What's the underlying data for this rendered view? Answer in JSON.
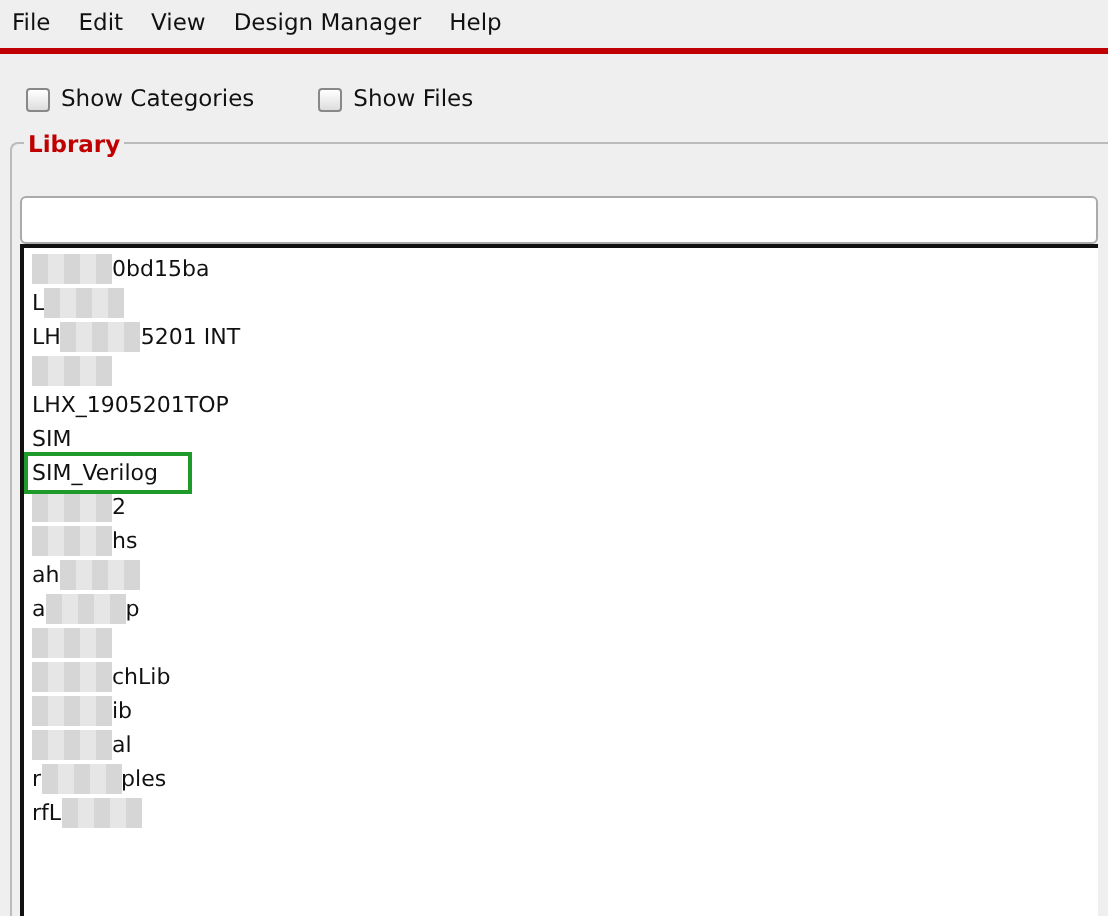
{
  "menu": [
    "File",
    "Edit",
    "View",
    "Design Manager",
    "Help"
  ],
  "options": [
    {
      "label": "Show Categories",
      "checked": false
    },
    {
      "label": "Show Files",
      "checked": false
    }
  ],
  "library": {
    "title": "Library",
    "items": [
      {
        "segments": [
          {
            "kind": "redacted"
          },
          {
            "kind": "text",
            "text": "0bd15ba"
          }
        ],
        "marked": false
      },
      {
        "segments": [
          {
            "kind": "text",
            "text": "L"
          },
          {
            "kind": "redacted"
          }
        ],
        "marked": false
      },
      {
        "segments": [
          {
            "kind": "text",
            "text": "LH"
          },
          {
            "kind": "redacted"
          },
          {
            "kind": "text",
            "text": "5201 INT"
          }
        ],
        "marked": false
      },
      {
        "segments": [
          {
            "kind": "redacted"
          }
        ],
        "marked": false
      },
      {
        "segments": [
          {
            "kind": "text",
            "text": "LHX_1905201TOP"
          }
        ],
        "marked": false
      },
      {
        "segments": [
          {
            "kind": "text",
            "text": "SIM"
          }
        ],
        "marked": false
      },
      {
        "segments": [
          {
            "kind": "text",
            "text": "SIM_Verilog"
          }
        ],
        "marked": true
      },
      {
        "segments": [
          {
            "kind": "redacted"
          },
          {
            "kind": "text",
            "text": "2"
          }
        ],
        "marked": false
      },
      {
        "segments": [
          {
            "kind": "redacted"
          },
          {
            "kind": "text",
            "text": "hs"
          }
        ],
        "marked": false
      },
      {
        "segments": [
          {
            "kind": "text",
            "text": "ah"
          },
          {
            "kind": "redacted"
          }
        ],
        "marked": false
      },
      {
        "segments": [
          {
            "kind": "text",
            "text": "a"
          },
          {
            "kind": "redacted"
          },
          {
            "kind": "text",
            "text": "p"
          }
        ],
        "marked": false
      },
      {
        "segments": [
          {
            "kind": "redacted"
          }
        ],
        "marked": false
      },
      {
        "segments": [
          {
            "kind": "redacted"
          },
          {
            "kind": "text",
            "text": "chLib"
          }
        ],
        "marked": false
      },
      {
        "segments": [
          {
            "kind": "redacted"
          },
          {
            "kind": "text",
            "text": "ib"
          }
        ],
        "marked": false
      },
      {
        "segments": [
          {
            "kind": "redacted"
          },
          {
            "kind": "text",
            "text": "al"
          }
        ],
        "marked": false
      },
      {
        "segments": [
          {
            "kind": "text",
            "text": "r"
          },
          {
            "kind": "redacted"
          },
          {
            "kind": "text",
            "text": "ples"
          }
        ],
        "marked": false
      },
      {
        "segments": [
          {
            "kind": "text",
            "text": "rfL"
          },
          {
            "kind": "redacted"
          }
        ],
        "marked": false
      }
    ]
  }
}
